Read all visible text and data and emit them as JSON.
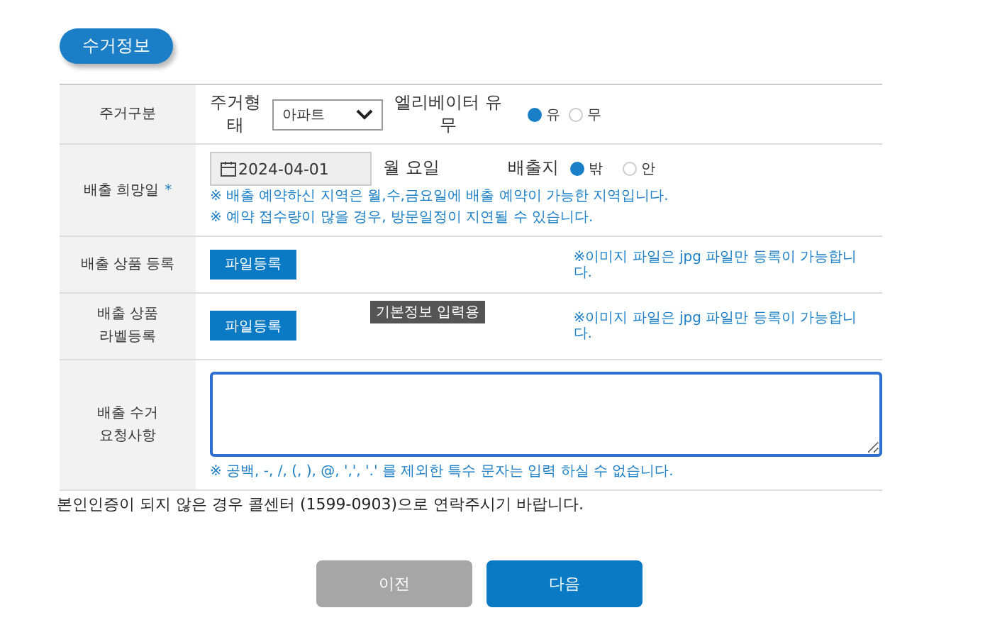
{
  "section_title": "수거정보",
  "rows": [
    {
      "kind": "housing",
      "label": "주거구분",
      "housing_type_label": "주거형\n태",
      "housing_type_value": "아파트",
      "elevator_label": "엘리베이터 유\n무",
      "options": [
        {
          "label": "유",
          "selected": true
        },
        {
          "label": "무",
          "selected": false
        }
      ]
    },
    {
      "kind": "date",
      "label": "배출 희망일",
      "required_mark": "*",
      "date_value": "2024-04-01",
      "weekday": "월 요일",
      "place_label": "배출지",
      "options": [
        {
          "label": "밖",
          "selected": true
        },
        {
          "label": "안",
          "selected": false
        }
      ],
      "notes": [
        "※ 배출 예약하신 지역은 월,수,금요일에 배출 예약이 가능한 지역입니다.",
        "※ 예약 접수량이 많을 경우, 방문일정이 지연될 수 있습니다."
      ]
    },
    {
      "kind": "file",
      "label": "배출 상품 등록",
      "button": "파일등록",
      "note": "※이미지 파일은 jpg 파일만 등록이 가능합니\n다."
    },
    {
      "kind": "file",
      "label": "배출 상품\n라벨등록",
      "button": "파일등록",
      "note": "※이미지 파일은 jpg 파일만 등록이 가능합니\n다.",
      "tooltip": "기본정보 입력용"
    },
    {
      "kind": "textarea",
      "label": "배출 수거\n요청사항",
      "note": "※ 공백, -, /, (, ), @, ',', '.' 를 제외한 특수 문자는 입력 하실 수 없습니다."
    }
  ],
  "notice": "본인인증이 되지 않은 경우 콜센터 (1599-0903)으로 연락주시기 바랍니다.",
  "buttons": [
    {
      "label": "이전",
      "kind": "secondary"
    },
    {
      "label": "다음",
      "kind": "primary"
    }
  ]
}
